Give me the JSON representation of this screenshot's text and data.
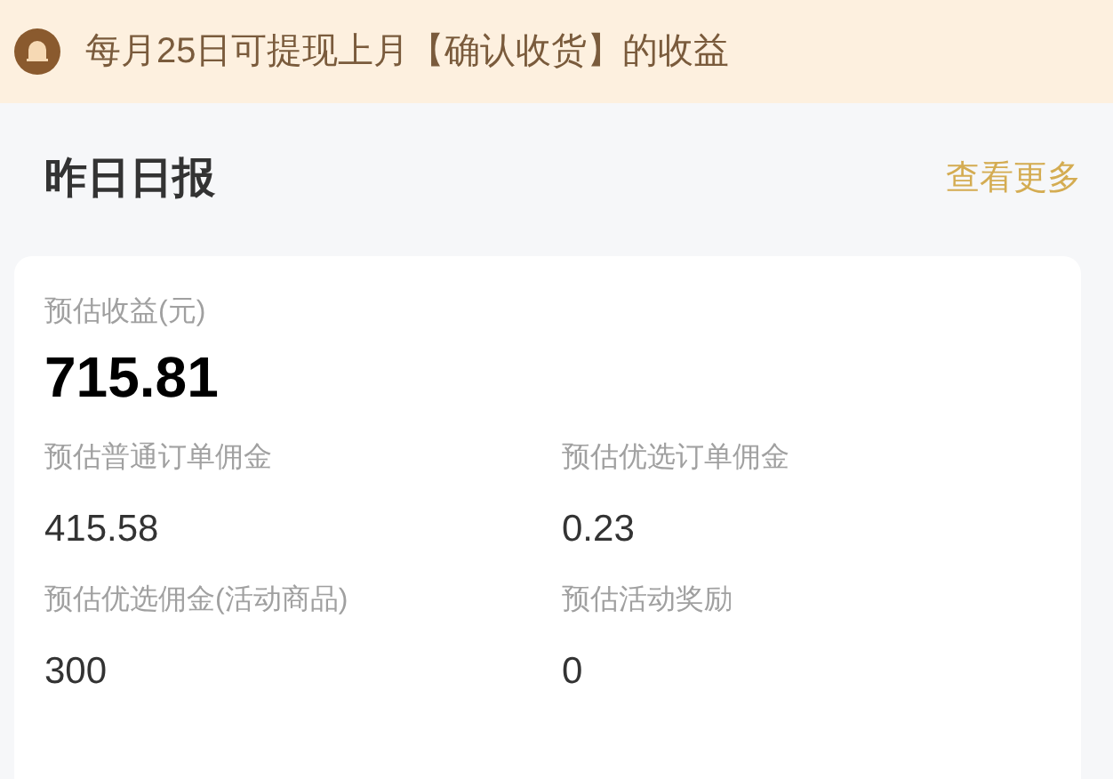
{
  "notice": {
    "text": "每月25日可提现上月【确认收货】的收益"
  },
  "report": {
    "title": "昨日日报",
    "more_link": "查看更多",
    "total": {
      "label": "预估收益(元)",
      "value": "715.81"
    },
    "metrics": [
      {
        "label": "预估普通订单佣金",
        "value": "415.58"
      },
      {
        "label": "预估优选订单佣金",
        "value": "0.23"
      },
      {
        "label": "预估优选佣金(活动商品)",
        "value": "300"
      },
      {
        "label": "预估活动奖励",
        "value": "0"
      }
    ]
  }
}
